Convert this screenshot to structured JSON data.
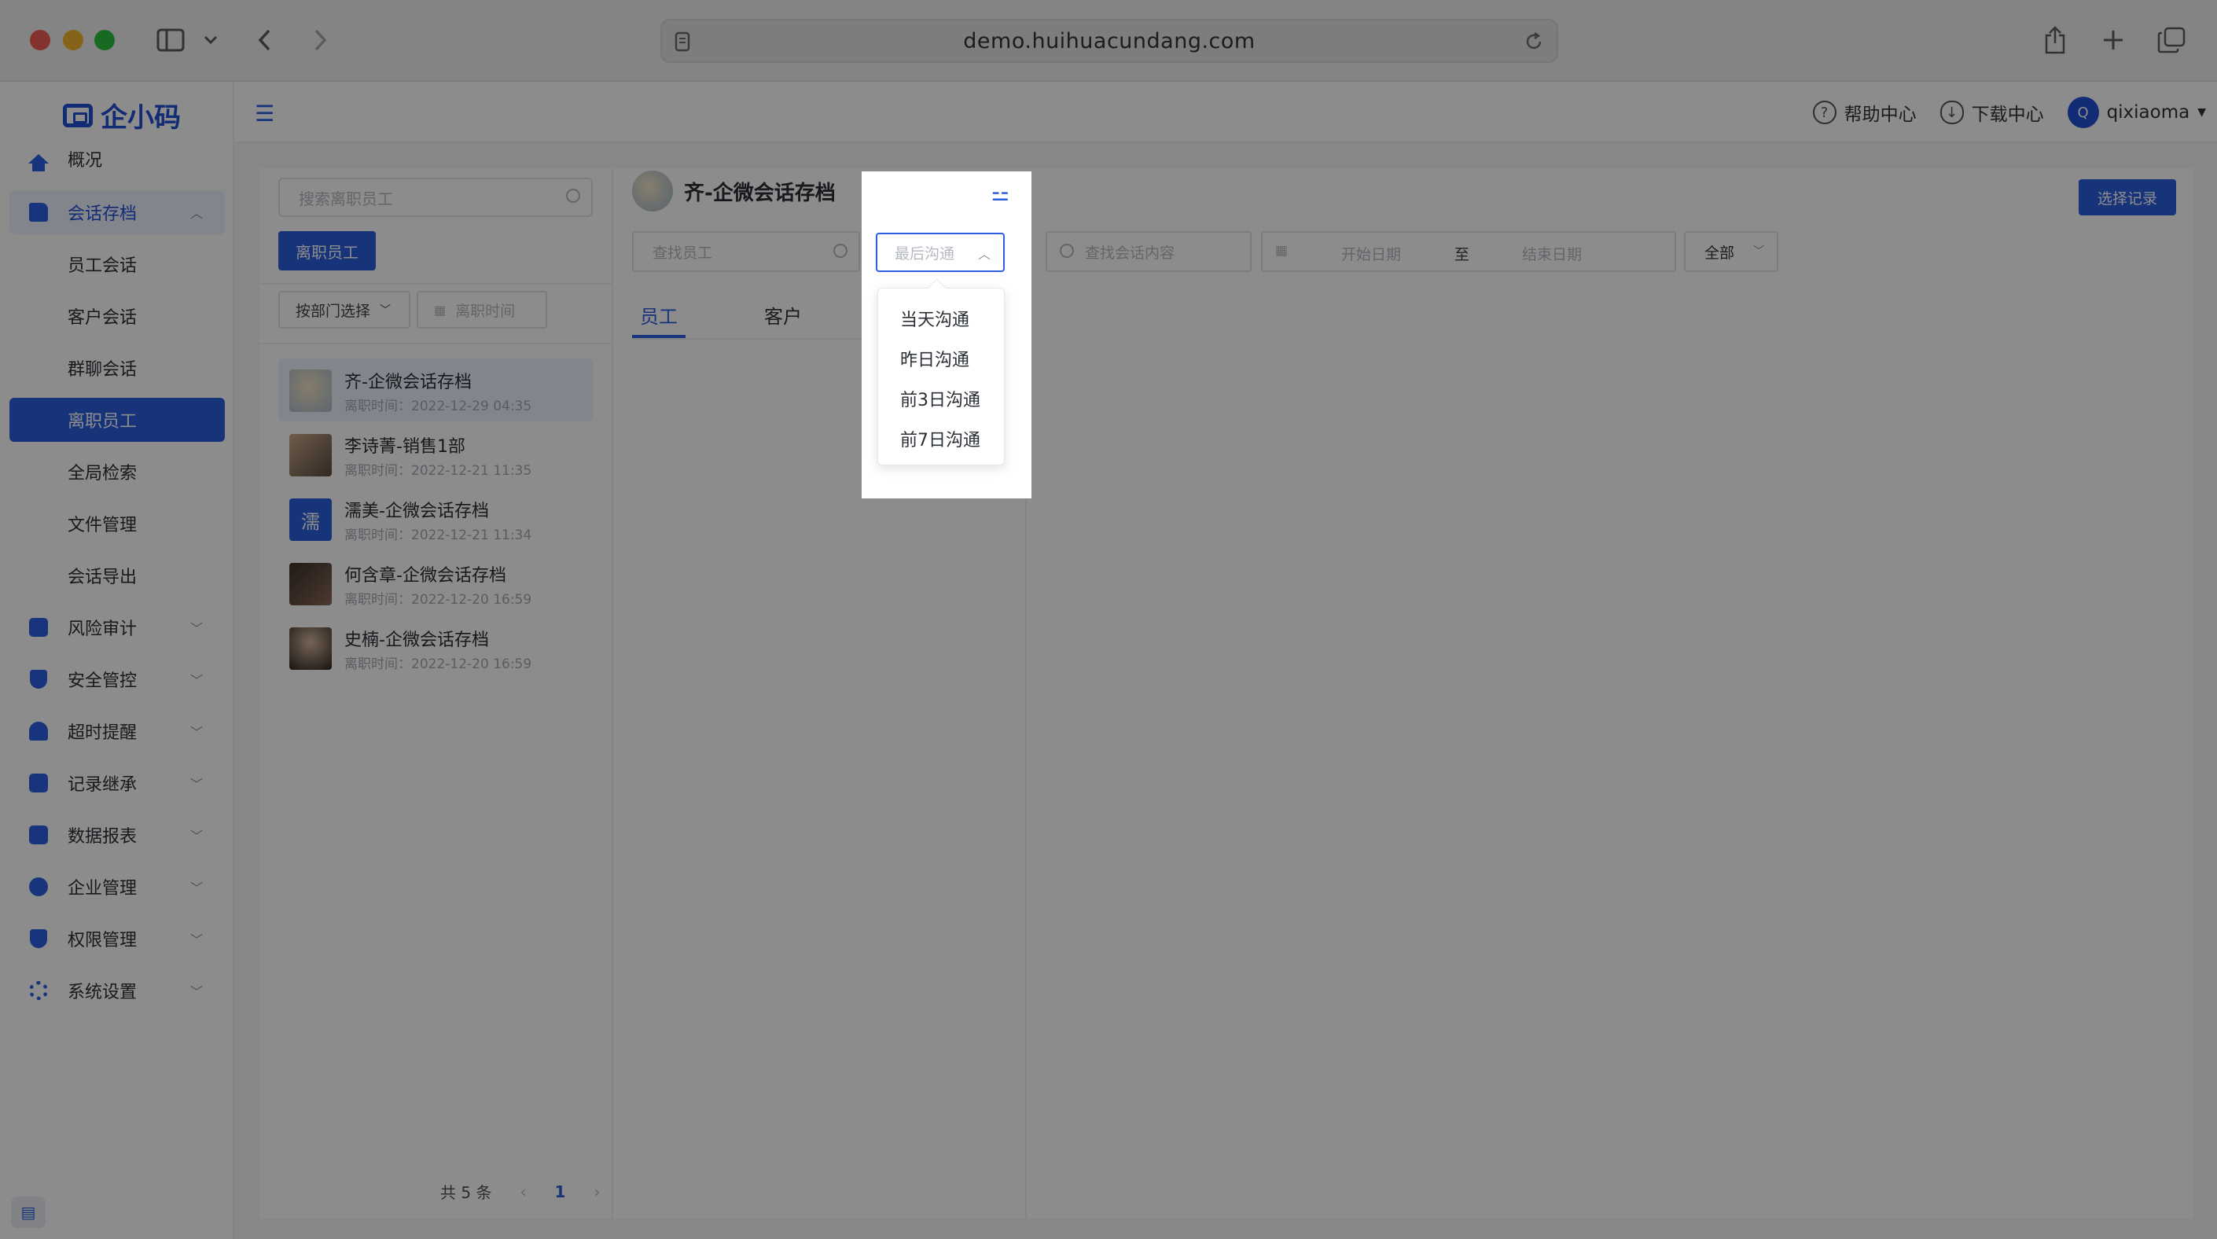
{
  "browser": {
    "url": "demo.huihuacundang.com"
  },
  "app": {
    "brand": "企小码"
  },
  "sidebar": {
    "items": [
      {
        "label": "概况",
        "icon": "home-icon"
      },
      {
        "label": "会话存档",
        "icon": "folder-icon",
        "expanded": true
      },
      {
        "label": "员工会话"
      },
      {
        "label": "客户会话"
      },
      {
        "label": "群聊会话"
      },
      {
        "label": "离职员工",
        "active": true
      },
      {
        "label": "全局检索"
      },
      {
        "label": "文件管理"
      },
      {
        "label": "会话导出"
      },
      {
        "label": "风险审计",
        "icon": "audit-icon"
      },
      {
        "label": "安全管控",
        "icon": "shield-icon"
      },
      {
        "label": "超时提醒",
        "icon": "bell-icon"
      },
      {
        "label": "记录继承",
        "icon": "inherit-icon"
      },
      {
        "label": "数据报表",
        "icon": "chart-icon"
      },
      {
        "label": "企业管理",
        "icon": "enterprise-icon"
      },
      {
        "label": "权限管理",
        "icon": "permission-icon"
      },
      {
        "label": "系统设置",
        "icon": "gear-icon"
      }
    ]
  },
  "topbar": {
    "help": "帮助中心",
    "download": "下载中心",
    "username": "qixiaoma",
    "avatar_letter": "Q"
  },
  "left_panel": {
    "search_placeholder": "搜索离职员工",
    "tab_button": "离职员工",
    "dept_select": "按部门选择",
    "time_filter": "离职时间",
    "people": [
      {
        "name": "齐-企微会话存档",
        "time": "离职时间：2022-12-29 04:35",
        "selected": true
      },
      {
        "name": "李诗菁-销售1部",
        "time": "离职时间：2022-12-21 11:35"
      },
      {
        "name": "濡美-企微会话存档",
        "time": "离职时间：2022-12-21 11:34",
        "letter": "濡"
      },
      {
        "name": "何含章-企微会话存档",
        "time": "离职时间：2022-12-20 16:59"
      },
      {
        "name": "史楠-企微会话存档",
        "time": "离职时间：2022-12-20 16:59"
      }
    ],
    "pager": {
      "total": "共 5 条",
      "current": "1"
    }
  },
  "right_panel": {
    "employee_name": "齐-企微会话存档",
    "choose_button": "选择记录",
    "find_employee_placeholder": "查找员工",
    "last_contact_placeholder": "最后沟通",
    "find_content_placeholder": "查找会话内容",
    "start_date": "开始日期",
    "to": "至",
    "end_date": "结束日期",
    "all_select": "全部",
    "tabs": [
      {
        "label": "员工",
        "active": true
      },
      {
        "label": "客户"
      }
    ]
  },
  "dropdown": {
    "options": [
      "当天沟通",
      "昨日沟通",
      "前3日沟通",
      "前7日沟通"
    ]
  }
}
